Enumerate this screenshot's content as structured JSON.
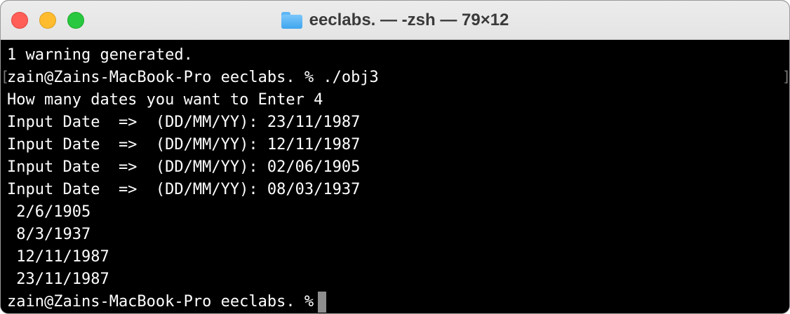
{
  "window": {
    "title": "eeclabs. — -zsh — 79×12"
  },
  "terminal": {
    "lines": [
      "1 warning generated.",
      "zain@Zains-MacBook-Pro eeclabs. % ./obj3",
      "How many dates you want to Enter 4",
      "Input Date  =>  (DD/MM/YY): 23/11/1987",
      "Input Date  =>  (DD/MM/YY): 12/11/1987",
      "Input Date  =>  (DD/MM/YY): 02/06/1905",
      "Input Date  =>  (DD/MM/YY): 08/03/1937",
      " 2/6/1905",
      " 8/3/1937",
      " 12/11/1987",
      " 23/11/1987"
    ],
    "prompt": "zain@Zains-MacBook-Pro eeclabs. %",
    "mark_left": "[",
    "mark_right": "]"
  },
  "colors": {
    "close": "#ff5f57",
    "minimize": "#febc2e",
    "zoom": "#28c840",
    "background": "#000000",
    "text": "#ffffff",
    "cursor": "#8e8e8e"
  },
  "icons": {
    "title": "folder-icon"
  }
}
